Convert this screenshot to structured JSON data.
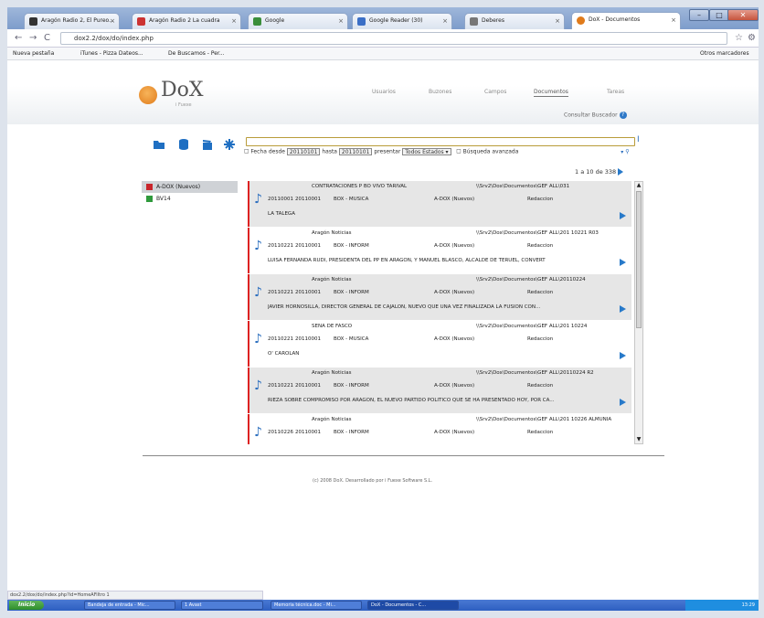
{
  "browser": {
    "tabs": [
      {
        "label": "Aragón Radio 2, El Pureo..."
      },
      {
        "label": "Aragón Radio 2 La cuadra"
      },
      {
        "label": "Google"
      },
      {
        "label": "Google Reader (30)"
      },
      {
        "label": "Deberes"
      },
      {
        "label": "DoX - Documentos"
      }
    ],
    "url": "dox2.2/dox/do/index.php",
    "bookmarks": [
      "Nueva pestaña",
      "iTunes - Pizza Dateos...",
      "De Buscamos - Per...",
      "Otros marcadores"
    ]
  },
  "site": {
    "logo_text": "DoX",
    "logo_sub": "i Fuexe",
    "menu": [
      "Usuarios",
      "Buzones",
      "Campos",
      "Documentos",
      "Tareas"
    ],
    "consulta_label": "Consultar Buscador"
  },
  "search": {
    "value": "",
    "fecha_desde_label": "Fecha desde",
    "fecha_desde": "20110101",
    "hasta_label": "hasta",
    "hasta": "20110101",
    "presentar_label": "presentar",
    "presentar_value": "Todos Estados",
    "avanzada_label": "Búsqueda avanzada"
  },
  "results_count": "1 a 10 de 338",
  "buzones": [
    {
      "label": "A-DOX (Nuevos)",
      "color": "#c8252b"
    },
    {
      "label": "BV14",
      "color": "#2f9a3c"
    }
  ],
  "results": [
    {
      "title": "CONTRATACIONES P BO VIVO TARIVAL",
      "path": "\\\\Srv2\\Dox\\Documentos\\GEF ALL\\031",
      "date": "20110001",
      "date2": "20110001",
      "section": "BOX - MUSICA",
      "buzon": "A-DOX (Nuevos)",
      "status": "Redaccion",
      "desc": "LA TALEGA"
    },
    {
      "title": "Aragón Noticias",
      "path": "\\\\Srv2\\Dox\\Documentos\\GEF ALL\\201 10221 R03",
      "date": "20110221",
      "date2": "20110001",
      "section": "BOX - INFORM",
      "buzon": "A-DOX (Nuevos)",
      "status": "Redaccion",
      "desc": "LUISA FERNANDA RUDI, PRESIDENTA DEL PP EN ARAGON, Y MANUEL BLASCO, ALCALDE DE TERUEL, CONVERT"
    },
    {
      "title": "Aragón Noticias",
      "path": "\\\\Srv2\\Dox\\Documentos\\GEF ALL\\20110224",
      "date": "20110221",
      "date2": "20110001",
      "section": "BOX - INFORM",
      "buzon": "A-DOX (Nuevos)",
      "status": "Redaccion",
      "desc": "JAVIER HORNOSILLA, DIRECTOR GENERAL DE CAJALON, NUEVO QUE UNA VEZ FINALIZADA LA FUSIÓN CON..."
    },
    {
      "title": "SENA DE FASCO",
      "path": "\\\\Srv2\\Dox\\Documentos\\GEF ALL\\201 10224",
      "date": "20110221",
      "date2": "20110001",
      "section": "BOX - MUSICA",
      "buzon": "A-DOX (Nuevos)",
      "status": "Redaccion",
      "desc": "O' CAROLAN"
    },
    {
      "title": "Aragón Noticias",
      "path": "\\\\Srv2\\Dox\\Documentos\\GEF ALL\\20110224 R2",
      "date": "20110221",
      "date2": "20110001",
      "section": "BOX - INFORM",
      "buzon": "A-DOX (Nuevos)",
      "status": "Redaccion",
      "desc": "RIEZA SOBRE COMPROMISO POR ARAGÓN, EL NUEVO PARTIDO POLÍTICO QUE SE HA PRESENTADO HOY, POR CA..."
    },
    {
      "title": "Aragón Noticias",
      "path": "\\\\Srv2\\Dox\\Documentos\\GEF ALL\\201 10226 ALMUNIA",
      "date": "20110226",
      "date2": "20110001",
      "section": "BOX - INFORM",
      "buzon": "A-DOX (Nuevos)",
      "status": "Redaccion",
      "desc": ""
    }
  ],
  "footer": "(c) 2008 DoX. Desarrollado por i Fuexe Software S.L.",
  "status_bar": "dox2.2/dox/do/index.php?id=HomeAFiltro 1",
  "taskbar": {
    "start": "Inicio",
    "tasks": [
      "Bandeja de entrada - Mic...",
      "1 Avast",
      "Memoria técnica.doc - Mi...",
      "DoX - Documentos - C..."
    ],
    "clock": "13:29"
  }
}
